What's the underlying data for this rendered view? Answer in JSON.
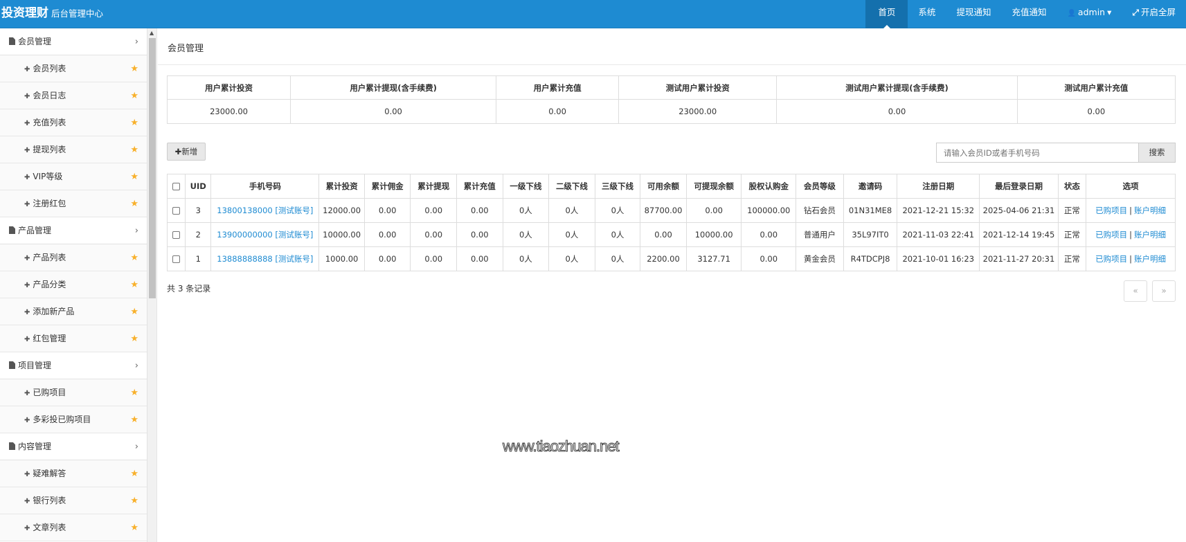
{
  "brand": {
    "name": "投资理财",
    "subtitle": "后台管理中心"
  },
  "nav": [
    {
      "label": "首页",
      "active": true,
      "icon": ""
    },
    {
      "label": "系统",
      "active": false,
      "icon": ""
    },
    {
      "label": "提现通知",
      "active": false,
      "icon": ""
    },
    {
      "label": "充值通知",
      "active": false,
      "icon": ""
    },
    {
      "label": "admin",
      "active": false,
      "icon": "user-icon",
      "caret": "▾"
    },
    {
      "label": "开启全屏",
      "active": false,
      "icon": "fullscreen-icon"
    }
  ],
  "sidebar": {
    "groups": [
      {
        "label": "会员管理",
        "items": [
          "会员列表",
          "会员日志",
          "充值列表",
          "提现列表",
          "VIP等级",
          "注册红包"
        ]
      },
      {
        "label": "产品管理",
        "items": [
          "产品列表",
          "产品分类",
          "添加新产品",
          "红包管理"
        ]
      },
      {
        "label": "项目管理",
        "items": [
          "已购项目",
          "多彩投已购项目"
        ]
      },
      {
        "label": "内容管理",
        "items": [
          "疑难解答",
          "银行列表",
          "文章列表"
        ]
      }
    ]
  },
  "page_title": "会员管理",
  "stats": {
    "headers": [
      "用户累计投资",
      "用户累计提现(含手续费)",
      "用户累计充值",
      "测试用户累计投资",
      "测试用户累计提现(含手续费)",
      "测试用户累计充值"
    ],
    "values": [
      "23000.00",
      "0.00",
      "0.00",
      "23000.00",
      "0.00",
      "0.00"
    ]
  },
  "toolbar": {
    "add_icon": "✚",
    "add_label": "新增",
    "search_placeholder": "请输入会员ID或者手机号码",
    "search_label": "搜索"
  },
  "table": {
    "headers": [
      "UID",
      "手机号码",
      "累计投资",
      "累计佣金",
      "累计提现",
      "累计充值",
      "一级下线",
      "二级下线",
      "三级下线",
      "可用余额",
      "可提现余额",
      "股权认购金",
      "会员等级",
      "邀请码",
      "注册日期",
      "最后登录日期",
      "状态",
      "选项"
    ],
    "rows": [
      {
        "uid": "3",
        "phone": "13800138000 [测试账号]",
        "invest": "12000.00",
        "commission": "0.00",
        "withdraw": "0.00",
        "recharge": "0.00",
        "l1": "0人",
        "l2": "0人",
        "l3": "0人",
        "balance": "87700.00",
        "withdrawable": "0.00",
        "equity": "100000.00",
        "level": "钻石会员",
        "invite": "01N31ME8",
        "reg": "2021-12-21 15:32",
        "last": "2025-04-06 21:31",
        "status": "正常",
        "link1": "已购项目",
        "sep": "|",
        "link2": "账户明细"
      },
      {
        "uid": "2",
        "phone": "13900000000 [测试账号]",
        "invest": "10000.00",
        "commission": "0.00",
        "withdraw": "0.00",
        "recharge": "0.00",
        "l1": "0人",
        "l2": "0人",
        "l3": "0人",
        "balance": "0.00",
        "withdrawable": "10000.00",
        "equity": "0.00",
        "level": "普通用户",
        "invite": "35L97IT0",
        "reg": "2021-11-03 22:41",
        "last": "2021-12-14 19:45",
        "status": "正常",
        "link1": "已购项目",
        "sep": "|",
        "link2": "账户明细"
      },
      {
        "uid": "1",
        "phone": "13888888888 [测试账号]",
        "invest": "1000.00",
        "commission": "0.00",
        "withdraw": "0.00",
        "recharge": "0.00",
        "l1": "0人",
        "l2": "0人",
        "l3": "0人",
        "balance": "2200.00",
        "withdrawable": "3127.71",
        "equity": "0.00",
        "level": "黄金会员",
        "invite": "R4TDCPJ8",
        "reg": "2021-10-01 16:23",
        "last": "2021-11-27 20:31",
        "status": "正常",
        "link1": "已购项目",
        "sep": "|",
        "link2": "账户明细"
      }
    ]
  },
  "total_text": "共 3 条记录",
  "pager": {
    "prev": "«",
    "next": "»"
  },
  "watermark": "www.tiaozhuan.net",
  "colors": {
    "topbar": "#1e8bd2",
    "nav_active": "#1470ad",
    "link": "#1e8bd2",
    "star": "#f8b02b"
  }
}
